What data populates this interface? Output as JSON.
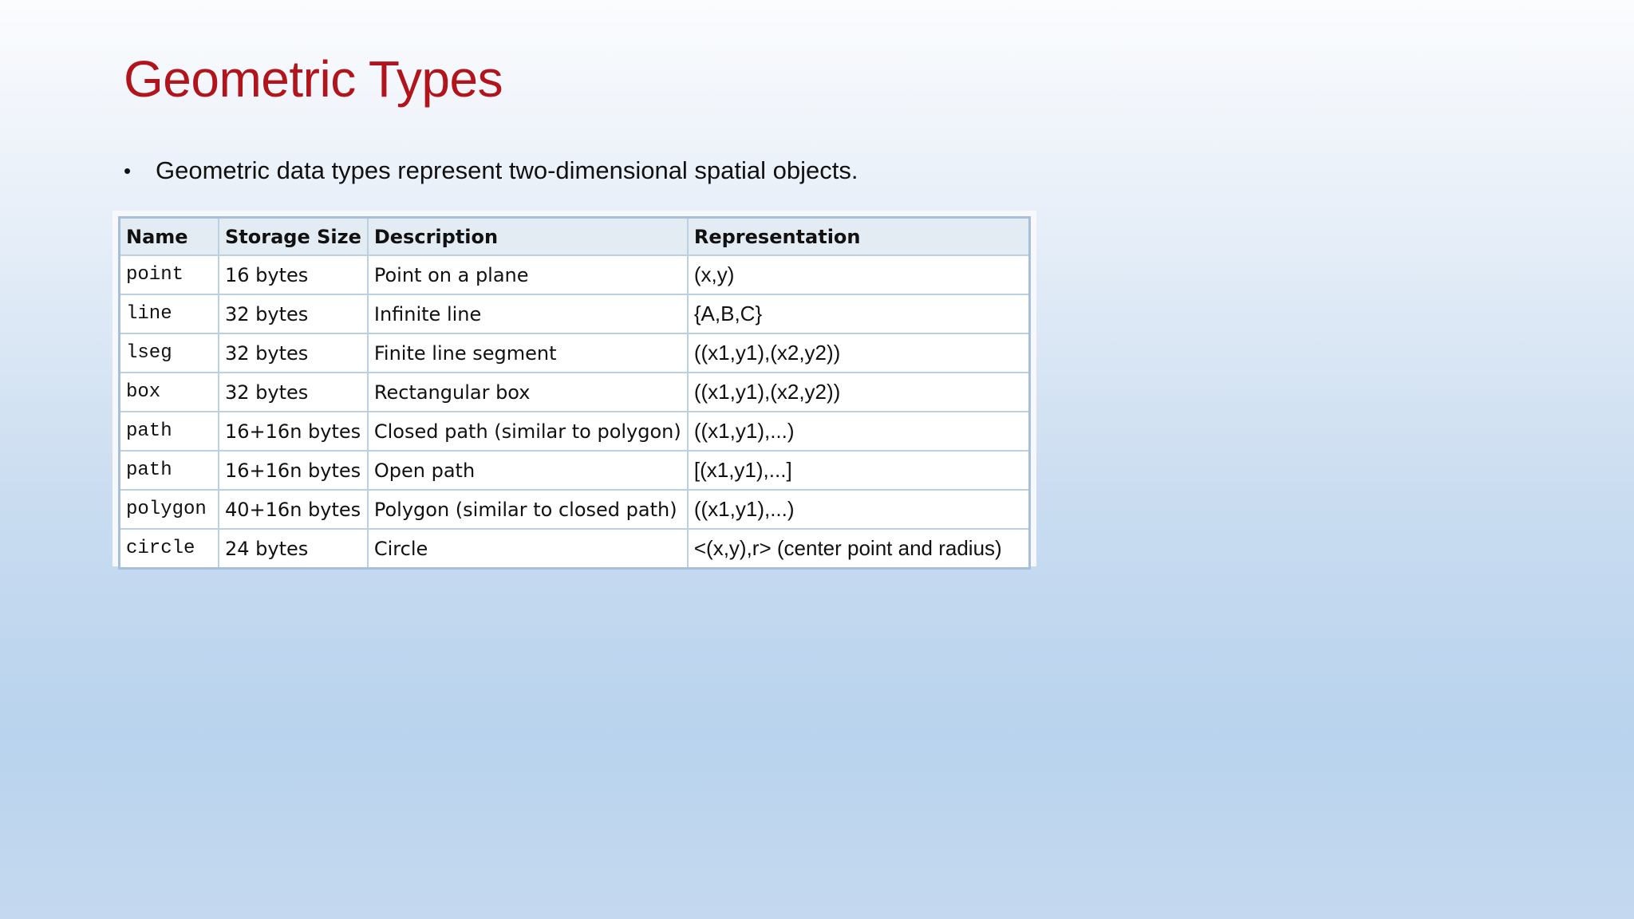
{
  "slide": {
    "title": "Geometric Types",
    "bullet": "Geometric data types represent two-dimensional spatial objects.",
    "title_color": "#b2141c"
  },
  "table": {
    "headers": [
      "Name",
      "Storage Size",
      "Description",
      "Representation"
    ],
    "rows": [
      {
        "name": "point",
        "size": "16 bytes",
        "description": "Point on a plane",
        "representation": "(x,y)"
      },
      {
        "name": "line",
        "size": "32 bytes",
        "description": "Infinite line",
        "representation": "{A,B,C}"
      },
      {
        "name": "lseg",
        "size": "32 bytes",
        "description": "Finite line segment",
        "representation": "((x1,y1),(x2,y2))"
      },
      {
        "name": "box",
        "size": "32 bytes",
        "description": "Rectangular box",
        "representation": "((x1,y1),(x2,y2))"
      },
      {
        "name": "path",
        "size": "16+16n bytes",
        "description": "Closed path (similar to polygon)",
        "representation": "((x1,y1),...)"
      },
      {
        "name": "path",
        "size": "16+16n bytes",
        "description": "Open path",
        "representation": "[(x1,y1),...]"
      },
      {
        "name": "polygon",
        "size": "40+16n bytes",
        "description": "Polygon (similar to closed path)",
        "representation": "((x1,y1),...)"
      },
      {
        "name": "circle",
        "size": "24 bytes",
        "description": "Circle",
        "representation": "<(x,y),r> (center point and radius)"
      }
    ]
  }
}
